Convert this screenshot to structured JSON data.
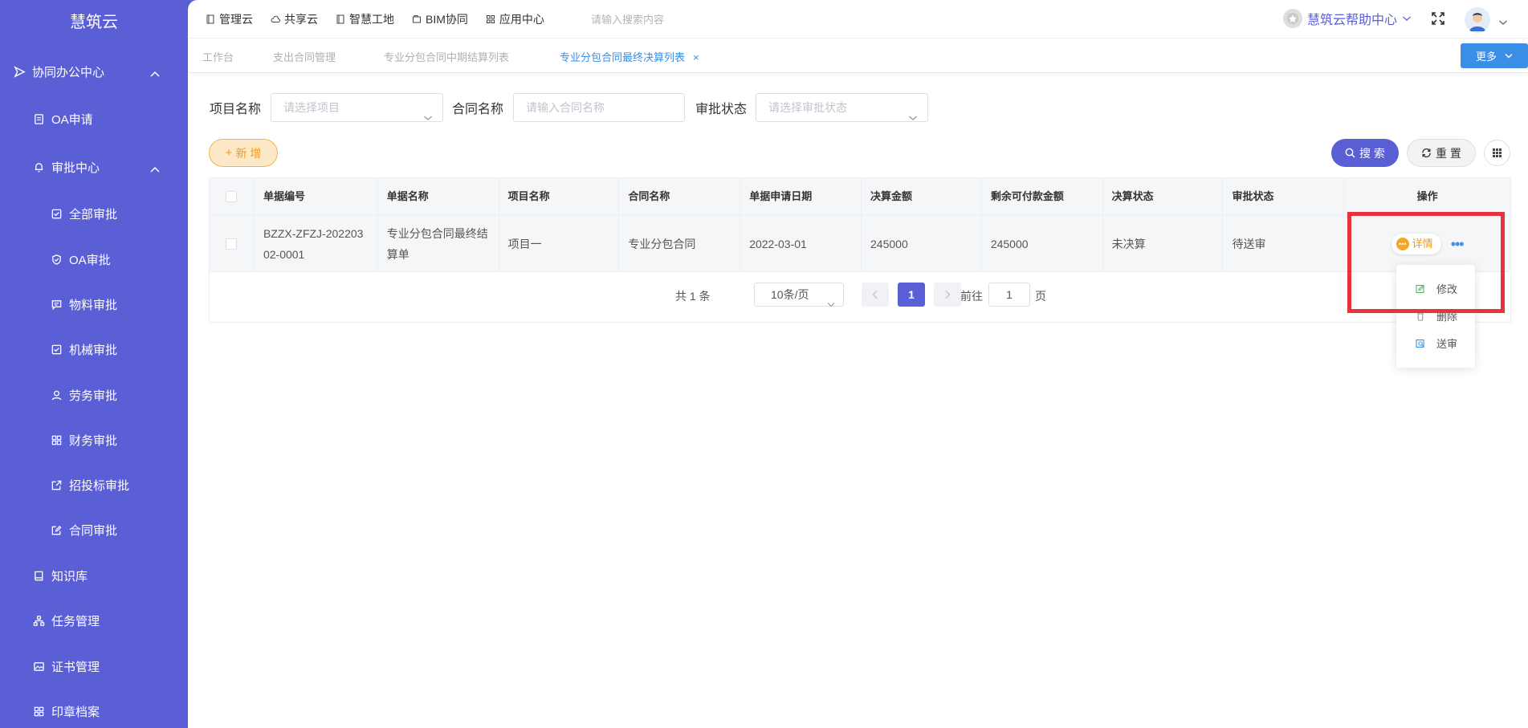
{
  "brand": "慧筑云",
  "sidebar": {
    "items": [
      {
        "label": "协同办公中心",
        "icon": "send-icon"
      },
      {
        "label": "OA申请",
        "icon": "document-icon"
      },
      {
        "label": "审批中心",
        "icon": "bell-icon"
      },
      {
        "label": "全部审批",
        "icon": "checkbox-icon"
      },
      {
        "label": "OA审批",
        "icon": "shield-check-icon"
      },
      {
        "label": "物料审批",
        "icon": "message-icon"
      },
      {
        "label": "机械审批",
        "icon": "checkbox-icon"
      },
      {
        "label": "劳务审批",
        "icon": "user-icon"
      },
      {
        "label": "财务审批",
        "icon": "grid-icon"
      },
      {
        "label": "招投标审批",
        "icon": "external-icon"
      },
      {
        "label": "合同审批",
        "icon": "edit-icon"
      },
      {
        "label": "知识库",
        "icon": "book-icon"
      },
      {
        "label": "任务管理",
        "icon": "sitemap-icon"
      },
      {
        "label": "证书管理",
        "icon": "image-icon"
      },
      {
        "label": "印章档案",
        "icon": "grid-icon"
      }
    ]
  },
  "topnav": {
    "items": [
      "管理云",
      "共享云",
      "智慧工地",
      "BIM协同",
      "应用中心"
    ],
    "search_placeholder": "请输入搜索内容",
    "help": "慧筑云帮助中心"
  },
  "tabs": {
    "items": [
      "工作台",
      "支出合同管理",
      "专业分包合同中期结算列表",
      "专业分包合同最终决算列表"
    ],
    "close": "×",
    "more": "更多"
  },
  "filters": {
    "project_label": "项目名称",
    "project_placeholder": "请选择项目",
    "contract_label": "合同名称",
    "contract_placeholder": "请输入合同名称",
    "status_label": "审批状态",
    "status_placeholder": "请选择审批状态"
  },
  "actions": {
    "add": "新 增",
    "search": "搜 索",
    "reset": "重 置"
  },
  "table": {
    "headers": [
      "单据编号",
      "单据名称",
      "项目名称",
      "合同名称",
      "单据申请日期",
      "决算金额",
      "剩余可付款金额",
      "决算状态",
      "审批状态",
      "操作"
    ],
    "rows": [
      {
        "code": "BZZX-ZFZJ-20220302-0001",
        "name": "专业分包合同最终结算单",
        "project": "项目一",
        "contract": "专业分包合同",
        "date": "2022-03-01",
        "amount": "245000",
        "remaining": "245000",
        "settle_status": "未决算",
        "approve_status": "待送审",
        "detail": "详情",
        "more": "•••"
      }
    ]
  },
  "pager": {
    "total": "共 1 条",
    "size": "10条/页",
    "current": "1",
    "goto": "前往",
    "goto_value": "1",
    "page": "页"
  },
  "menu": {
    "items": [
      "修改",
      "删除",
      "送审"
    ]
  },
  "colors": {
    "primary": "#5b5fd6",
    "accent_blue": "#3a8ee6",
    "orange": "#f09a1a",
    "highlight": "#e8323c"
  }
}
